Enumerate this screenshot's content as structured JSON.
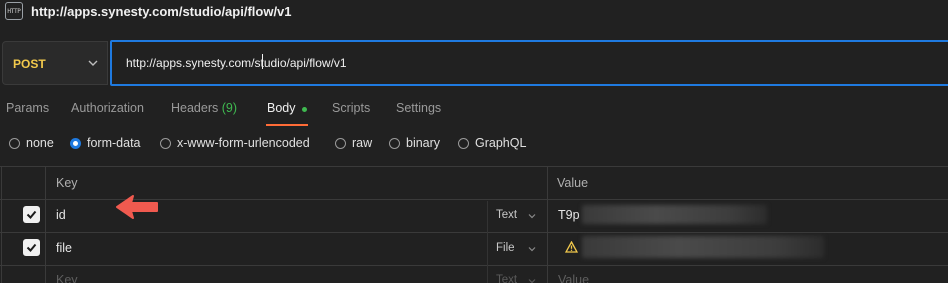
{
  "titlebar": {
    "badge_text": "HTTP",
    "url": "http://apps.synesty.com/studio/api/flow/v1"
  },
  "request": {
    "method": "POST",
    "method_color": "#f2c94c",
    "url": "http://apps.synesty.com/studio/api/flow/v1"
  },
  "tabs": [
    {
      "label": "Params"
    },
    {
      "label": "Authorization"
    },
    {
      "label": "Headers",
      "count": "(9)"
    },
    {
      "label": "Body",
      "active": true
    },
    {
      "label": "Scripts"
    },
    {
      "label": "Settings"
    }
  ],
  "body_modes": [
    {
      "label": "none",
      "selected": false
    },
    {
      "label": "form-data",
      "selected": true
    },
    {
      "label": "x-www-form-urlencoded",
      "selected": false
    },
    {
      "label": "raw",
      "selected": false
    },
    {
      "label": "binary",
      "selected": false
    },
    {
      "label": "GraphQL",
      "selected": false
    }
  ],
  "table": {
    "headers": {
      "key": "Key",
      "value": "Value"
    },
    "rows": [
      {
        "checked": true,
        "key": "id",
        "type": "Text",
        "value": "T9p"
      },
      {
        "checked": true,
        "key": "file",
        "type": "File",
        "value": ""
      },
      {
        "checked": false,
        "key": "Key",
        "type": "Text",
        "value": "Value",
        "placeholder": true
      }
    ]
  },
  "colors": {
    "accent": "#1f7ae0",
    "active_tab_underline": "#ff6c37",
    "annotation_arrow": "#f05a4f"
  }
}
